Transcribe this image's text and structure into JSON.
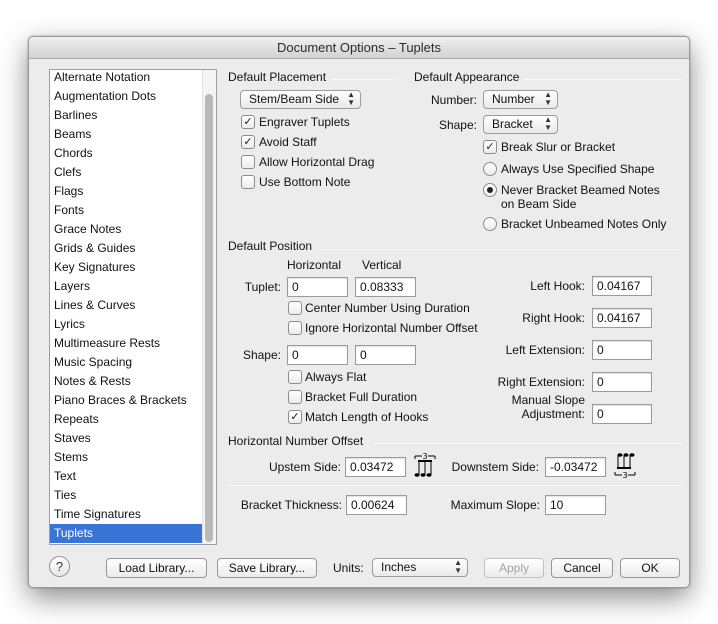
{
  "window": {
    "title": "Document Options – Tuplets"
  },
  "sidebar": {
    "items": [
      {
        "label": "Alternate Notation"
      },
      {
        "label": "Augmentation Dots"
      },
      {
        "label": "Barlines"
      },
      {
        "label": "Beams"
      },
      {
        "label": "Chords"
      },
      {
        "label": "Clefs"
      },
      {
        "label": "Flags"
      },
      {
        "label": "Fonts"
      },
      {
        "label": "Grace Notes"
      },
      {
        "label": "Grids & Guides"
      },
      {
        "label": "Key Signatures"
      },
      {
        "label": "Layers"
      },
      {
        "label": "Lines & Curves"
      },
      {
        "label": "Lyrics"
      },
      {
        "label": "Multimeasure Rests"
      },
      {
        "label": "Music Spacing"
      },
      {
        "label": "Notes & Rests"
      },
      {
        "label": "Piano Braces & Brackets"
      },
      {
        "label": "Repeats"
      },
      {
        "label": "Staves"
      },
      {
        "label": "Stems"
      },
      {
        "label": "Text"
      },
      {
        "label": "Ties"
      },
      {
        "label": "Time Signatures"
      },
      {
        "label": "Tuplets"
      }
    ],
    "selected": "Tuplets"
  },
  "placement": {
    "header": "Default Placement",
    "popup": "Stem/Beam Side",
    "engraver_tuplets": {
      "label": "Engraver Tuplets",
      "checked": true
    },
    "avoid_staff": {
      "label": "Avoid Staff",
      "checked": true
    },
    "allow_horizontal_drag": {
      "label": "Allow Horizontal Drag",
      "checked": false
    },
    "use_bottom_note": {
      "label": "Use Bottom Note",
      "checked": false
    }
  },
  "appearance": {
    "header": "Default Appearance",
    "number_label": "Number:",
    "number_value": "Number",
    "shape_label": "Shape:",
    "shape_value": "Bracket",
    "break_slur": {
      "label": "Break Slur or Bracket",
      "checked": true
    },
    "radio_always": {
      "label": "Always Use Specified Shape",
      "selected": false
    },
    "radio_never_1": "Never Bracket Beamed Notes",
    "radio_never_2": "on Beam Side",
    "radio_never_selected": true,
    "radio_unbeamed": {
      "label": "Bracket Unbeamed Notes Only",
      "selected": false
    }
  },
  "position": {
    "header": "Default Position",
    "col_horizontal": "Horizontal",
    "col_vertical": "Vertical",
    "tuplet_label": "Tuplet:",
    "tuplet_h": "0",
    "tuplet_v": "0.08333",
    "center_number": {
      "label": "Center Number Using Duration",
      "checked": false
    },
    "ignore_offset": {
      "label": "Ignore Horizontal Number Offset",
      "checked": false
    },
    "shape_label": "Shape:",
    "shape_h": "0",
    "shape_v": "0",
    "always_flat": {
      "label": "Always Flat",
      "checked": false
    },
    "bracket_full": {
      "label": "Bracket Full Duration",
      "checked": false
    },
    "match_hooks": {
      "label": "Match Length of Hooks",
      "checked": true
    },
    "left_hook_label": "Left Hook:",
    "left_hook": "0.04167",
    "right_hook_label": "Right Hook:",
    "right_hook": "0.04167",
    "left_ext_label": "Left Extension:",
    "left_ext": "0",
    "right_ext_label": "Right Extension:",
    "right_ext": "0",
    "manual_slope_1": "Manual Slope",
    "manual_slope_2": "Adjustment:",
    "manual_slope": "0"
  },
  "offset": {
    "header": "Horizontal Number Offset",
    "upstem_label": "Upstem Side:",
    "upstem": "0.03472",
    "downstem_label": "Downstem Side:",
    "downstem": "-0.03472",
    "upstem_icon_digit": "3",
    "downstem_icon_digit": "3"
  },
  "bracket": {
    "thickness_label": "Bracket Thickness:",
    "thickness": "0.00624",
    "max_slope_label": "Maximum Slope:",
    "max_slope": "10"
  },
  "footer": {
    "help": "?",
    "load_library": "Load Library...",
    "save_library": "Save Library...",
    "units_label": "Units:",
    "units_value": "Inches",
    "apply": "Apply",
    "cancel": "Cancel",
    "ok": "OK"
  }
}
